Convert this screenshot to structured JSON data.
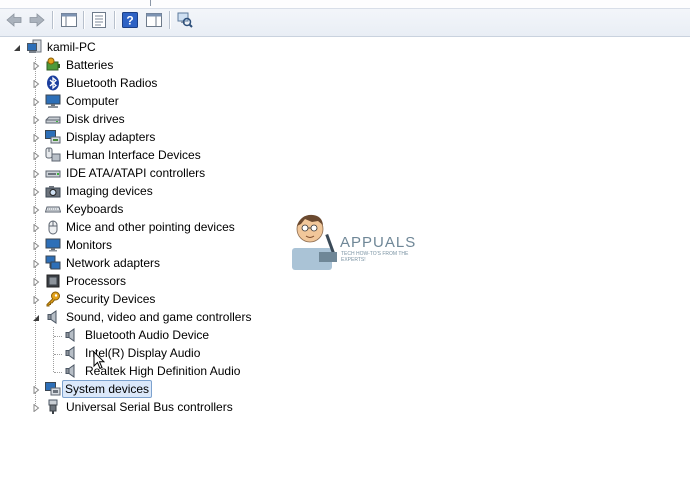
{
  "toolbar": {
    "buttons": [
      "back-icon",
      "forward-icon",
      "show-hide-console-tree-icon",
      "properties-icon",
      "help-icon",
      "action-pane-icon",
      "scan-hardware-icon"
    ]
  },
  "tree": {
    "root": "kamil-PC",
    "categories": [
      {
        "label": "Batteries",
        "icon": "battery-icon",
        "expanded": false
      },
      {
        "label": "Bluetooth Radios",
        "icon": "bluetooth-icon",
        "expanded": false
      },
      {
        "label": "Computer",
        "icon": "computer-icon",
        "expanded": false
      },
      {
        "label": "Disk drives",
        "icon": "disk-drive-icon",
        "expanded": false
      },
      {
        "label": "Display adapters",
        "icon": "display-adapter-icon",
        "expanded": false
      },
      {
        "label": "Human Interface Devices",
        "icon": "hid-icon",
        "expanded": false
      },
      {
        "label": "IDE ATA/ATAPI controllers",
        "icon": "ide-controller-icon",
        "expanded": false
      },
      {
        "label": "Imaging devices",
        "icon": "camera-icon",
        "expanded": false
      },
      {
        "label": "Keyboards",
        "icon": "keyboard-icon",
        "expanded": false
      },
      {
        "label": "Mice and other pointing devices",
        "icon": "mouse-icon",
        "expanded": false
      },
      {
        "label": "Monitors",
        "icon": "monitor-icon",
        "expanded": false
      },
      {
        "label": "Network adapters",
        "icon": "network-adapter-icon",
        "expanded": false
      },
      {
        "label": "Processors",
        "icon": "processor-icon",
        "expanded": false
      },
      {
        "label": "Security Devices",
        "icon": "key-icon",
        "expanded": false
      },
      {
        "label": "Sound, video and game controllers",
        "icon": "speaker-icon",
        "expanded": true,
        "children": [
          "Bluetooth Audio Device",
          "Intel(R) Display Audio",
          "Realtek High Definition Audio"
        ]
      },
      {
        "label": "System devices",
        "icon": "system-devices-icon",
        "expanded": false,
        "selected": true
      },
      {
        "label": "Universal Serial Bus controllers",
        "icon": "usb-icon",
        "expanded": false
      }
    ]
  },
  "watermark": {
    "brand": "APPUALS",
    "tagline": "TECH HOW-TO'S FROM THE EXPERTS!"
  }
}
